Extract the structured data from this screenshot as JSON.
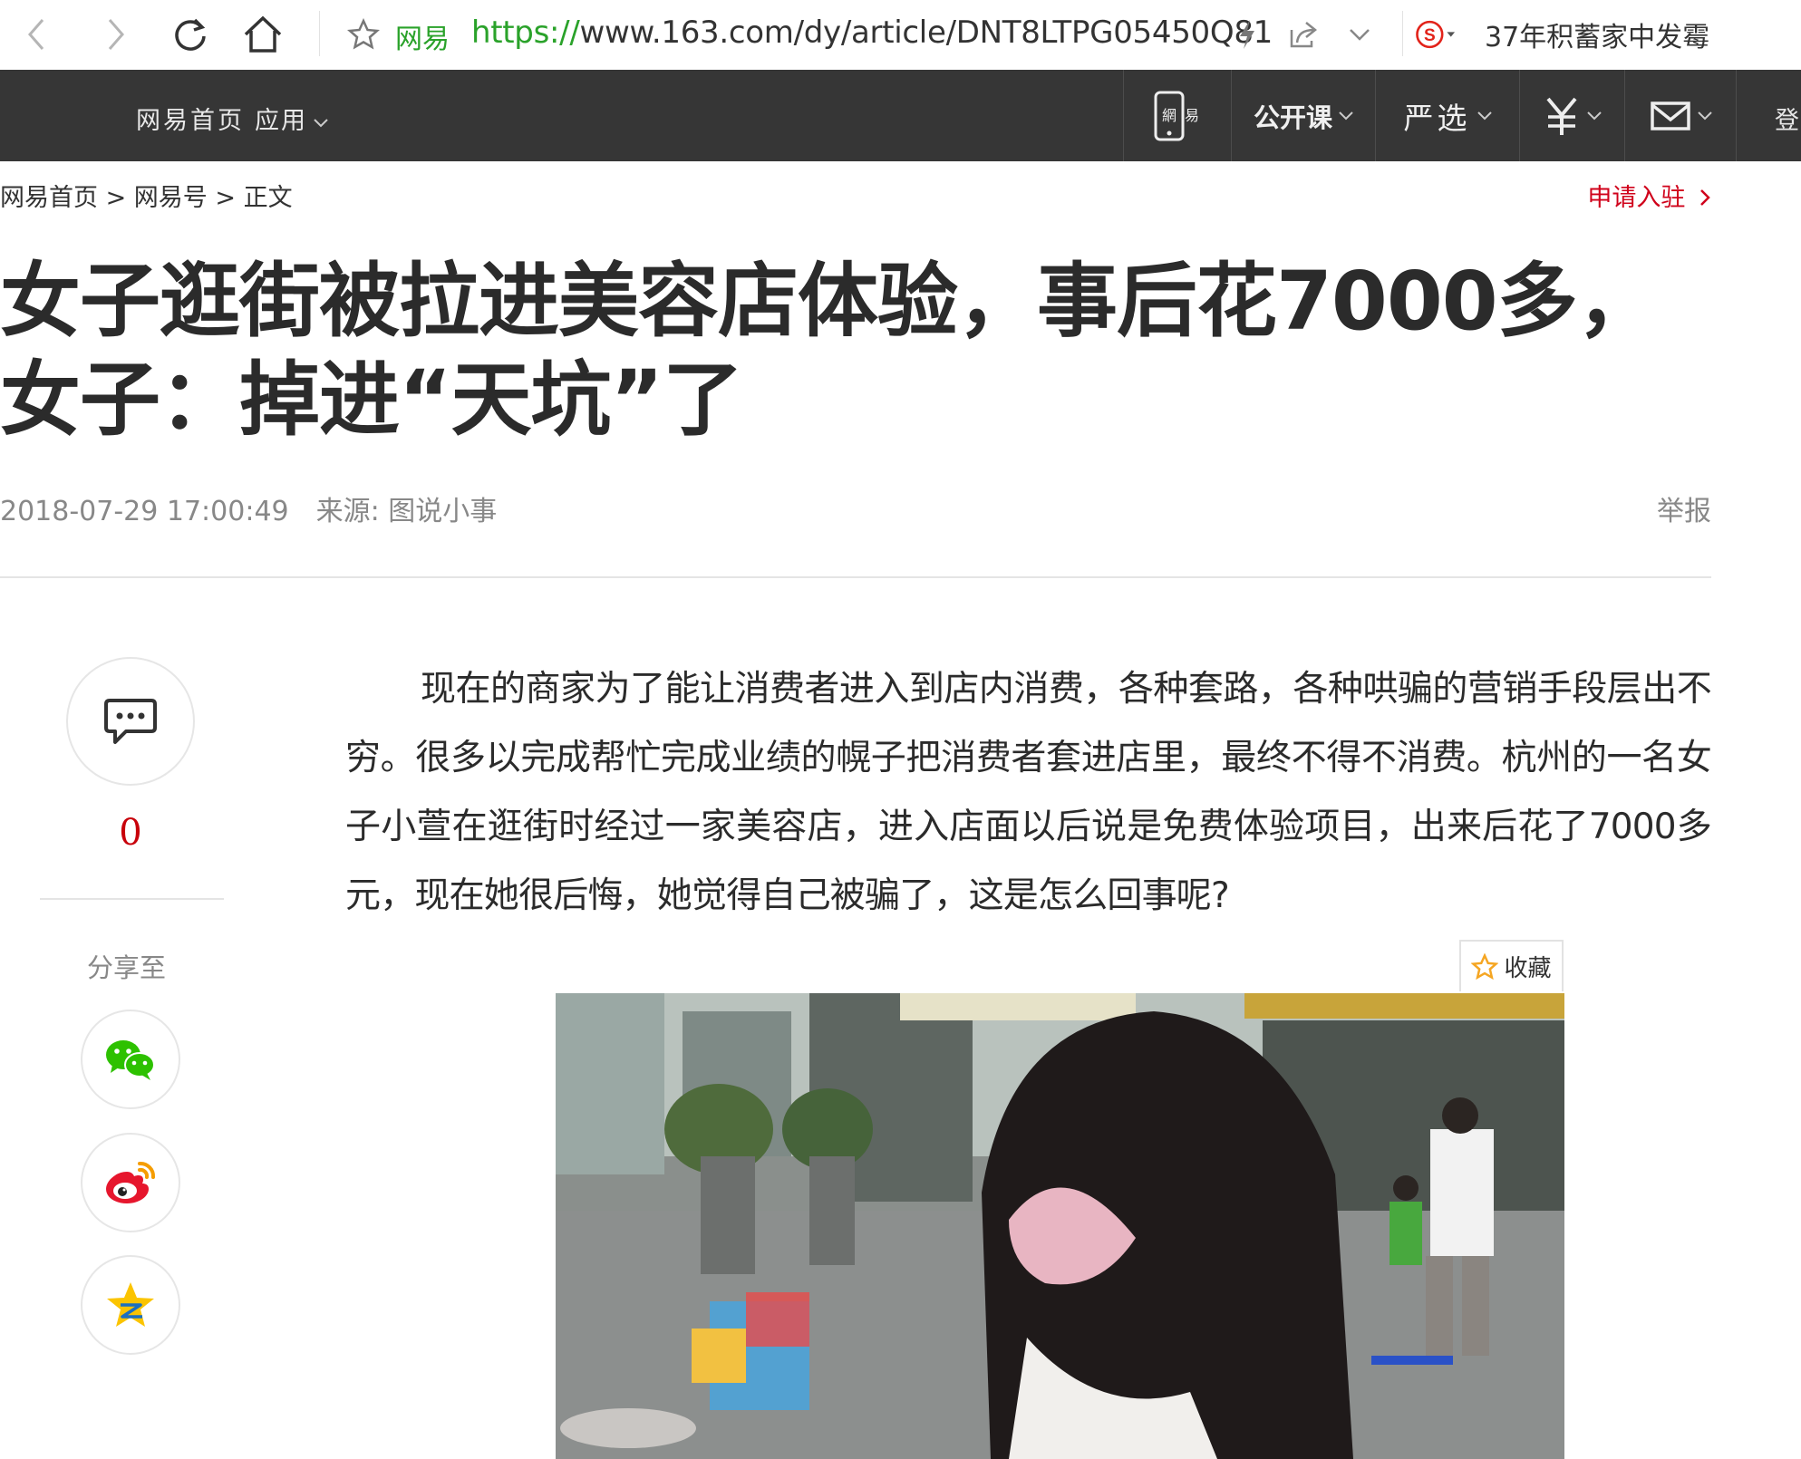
{
  "browser": {
    "site_label": "网易",
    "url_scheme": "https://",
    "url_rest": "www.163.com/dy/article/DNT8LTPG05450Q81",
    "search_text": "37年积蓄家中发霉"
  },
  "site_nav": {
    "home": "网易首页",
    "app": "应用",
    "open_course": "公开课",
    "yanxuan": "严选",
    "login": "登"
  },
  "breadcrumb": {
    "home": "网易首页",
    "sep1": " > ",
    "section": "网易号",
    "sep2": " > ",
    "current": "正文"
  },
  "apply_link": "申请入驻",
  "article": {
    "title": "女子逛街被拉进美容店体验，事后花7000多，女子：掉进“天坑”了",
    "datetime": "2018-07-29 17:00:49",
    "source": "来源: 图说小事",
    "report": "举报",
    "paragraph": "现在的商家为了能让消费者进入到店内消费，各种套路，各种哄骗的营销手段层出不穷。很多以完成帮忙完成业绩的幌子把消费者套进店里，最终不得不消费。杭州的一名女子小萱在逛街时经过一家美容店，进入店面以后说是免费体验项目，出来后花了7000多元，现在她很后悔，她觉得自己被骗了，这是怎么回事呢?",
    "collect": "收藏"
  },
  "rail": {
    "comment_count": "0",
    "share_label": "分享至"
  },
  "colors": {
    "nav_bg": "#363636",
    "accent_red": "#d0021b",
    "url_green": "#2aa22a"
  }
}
